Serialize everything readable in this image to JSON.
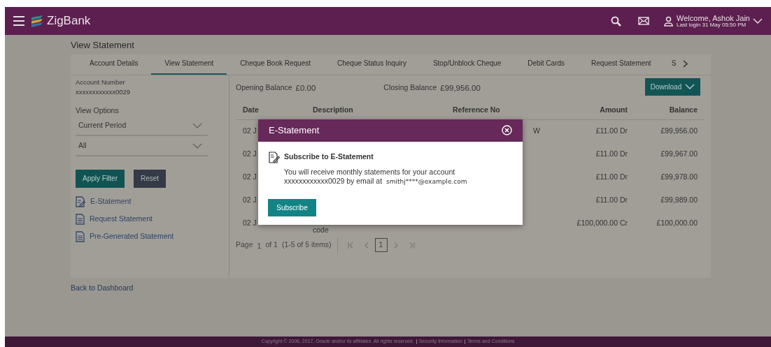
{
  "header": {
    "brand": "ZigBank",
    "welcome": "Welcome, Ashok Jain",
    "last_login": "Last login 31 May 05:50 PM"
  },
  "page_title": "View Statement",
  "tabs": [
    {
      "label": "Account Details",
      "selected": false
    },
    {
      "label": "View Statement",
      "selected": true
    },
    {
      "label": "Cheque Book Request",
      "selected": false
    },
    {
      "label": "Cheque Status Inquiry",
      "selected": false
    },
    {
      "label": "Stop/Unblock Cheque",
      "selected": false
    },
    {
      "label": "Debit Cards",
      "selected": false
    },
    {
      "label": "Request Statement",
      "selected": false
    },
    {
      "label": "S",
      "selected": false
    }
  ],
  "sidebar": {
    "account_label": "Account Number",
    "account_value": "xxxxxxxxxxxx0029",
    "view_options_label": "View Options",
    "selects": [
      "Current Period",
      "All"
    ],
    "apply_button": "Apply Filter",
    "reset_button": "Reset",
    "links": [
      {
        "kind": "edit",
        "label": "E-Statement"
      },
      {
        "kind": "doc",
        "label": "Request Statement"
      },
      {
        "kind": "doc",
        "label": "Pre-Generated Statement"
      }
    ]
  },
  "balances": {
    "opening_label": "Opening Balance",
    "opening_value": "£0.00",
    "closing_label": "Closing Balance",
    "closing_value": "£99,956.00",
    "download_button": "Download"
  },
  "table": {
    "columns": [
      "Date",
      "Description",
      "Reference No",
      "Amount",
      "Balance"
    ],
    "rows": [
      {
        "date": "02 J",
        "description": "",
        "reference": "W",
        "amount": "£11.00 Dr",
        "balance": "£99,956.00"
      },
      {
        "date": "02 J",
        "description": "",
        "reference": "",
        "amount": "£11.00 Dr",
        "balance": "£99,967.00"
      },
      {
        "date": "02 J",
        "description": "",
        "reference": "",
        "amount": "£11.00 Dr",
        "balance": "£99,978.00"
      },
      {
        "date": "02 J",
        "description": "",
        "reference": "",
        "amount": "£11.00 Dr",
        "balance": "£99,989.00"
      },
      {
        "date": "02 J",
        "description": "code",
        "reference": "",
        "amount": "£100,000.00 Cr",
        "balance": "£100,000.00"
      }
    ]
  },
  "pagination": {
    "page_label": "Page",
    "page_value": "1",
    "of_label": "of 1",
    "items": "(1-5 of 5 items)",
    "current": "1"
  },
  "back_link": "Back to Dashboard",
  "modal": {
    "title": "E-Statement",
    "heading": "Subscribe to E-Statement",
    "text": "You will receive monthly statements for your account xxxxxxxxxxxx0029 by email at",
    "email": "smithj****@example.com",
    "button": "Subscribe"
  },
  "footer": {
    "copyright": "Copyright © 2006, 2017, Oracle and/or its affiliates. All rights reserved.",
    "links": [
      "Security Information",
      "Terms and Conditions"
    ]
  }
}
